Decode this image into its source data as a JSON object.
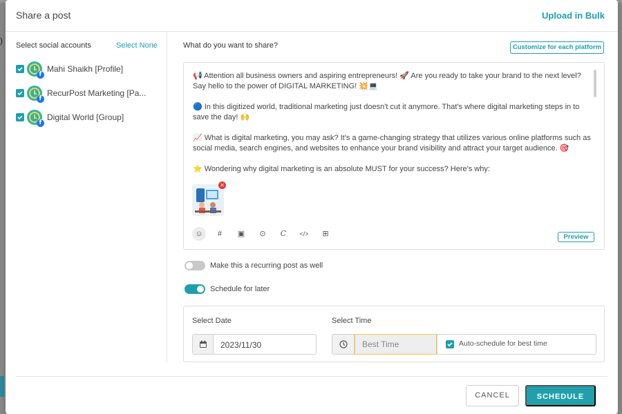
{
  "background": {
    "left_stub_text": ")"
  },
  "modal": {
    "title": "Share a post",
    "upload_bulk": "Upload in Bulk"
  },
  "accounts": {
    "label": "Select social accounts",
    "select_none": "Select None",
    "items": [
      {
        "name": "Mahi Shaikh [Profile]",
        "checked": true,
        "network": "facebook"
      },
      {
        "name": "RecurPost Marketing [Pa...",
        "checked": true,
        "network": "facebook"
      },
      {
        "name": "Digital World [Group]",
        "checked": true,
        "network": "facebook"
      }
    ]
  },
  "composer": {
    "label": "What do you want to share?",
    "customize_button": "Customize for each platform",
    "paragraphs": [
      "📢 Attention all business owners and aspiring entrepreneurs! 🚀 Are you ready to take your brand to the next level? Say hello to the power of DIGITAL MARKETING! 💥💻",
      "🔵 In this digitized world, traditional marketing just doesn't cut it anymore. That's where digital marketing steps in to save the day! 🙌",
      "📈 What is digital marketing, you may ask? It's a game-changing strategy that utilizes various online platforms such as social media, search engines, and websites to enhance your brand visibility and attract your target audience. 🎯",
      "⭐ Wondering why digital marketing is an absolute MUST for your success? Here's why:"
    ],
    "toolbar": [
      {
        "icon": "emoji-icon",
        "glyph": "☺"
      },
      {
        "icon": "hashtag-icon",
        "glyph": "#"
      },
      {
        "icon": "image-icon",
        "glyph": "▣"
      },
      {
        "icon": "video-icon",
        "glyph": "⊙"
      },
      {
        "icon": "canva-icon",
        "glyph": "C"
      },
      {
        "icon": "code-icon",
        "glyph": "</>"
      },
      {
        "icon": "ai-bot-icon",
        "glyph": "⊞"
      }
    ],
    "preview_button": "Preview"
  },
  "options": {
    "recurring_label": "Make this a recurring post as well",
    "recurring_on": false,
    "schedule_later_label": "Schedule for later",
    "schedule_later_on": true
  },
  "schedule": {
    "date_label": "Select Date",
    "date_value": "2023/11/30",
    "time_label": "Select Time",
    "time_placeholder": "Best Time",
    "auto_label": "Auto-schedule for best time",
    "auto_checked": true
  },
  "footer": {
    "cancel": "CANCEL",
    "schedule": "SCHEDULE"
  },
  "colors": {
    "accent": "#1d9fae",
    "facebook": "#1877f2",
    "remove": "#e53935",
    "time_highlight": "#f0c84e"
  }
}
